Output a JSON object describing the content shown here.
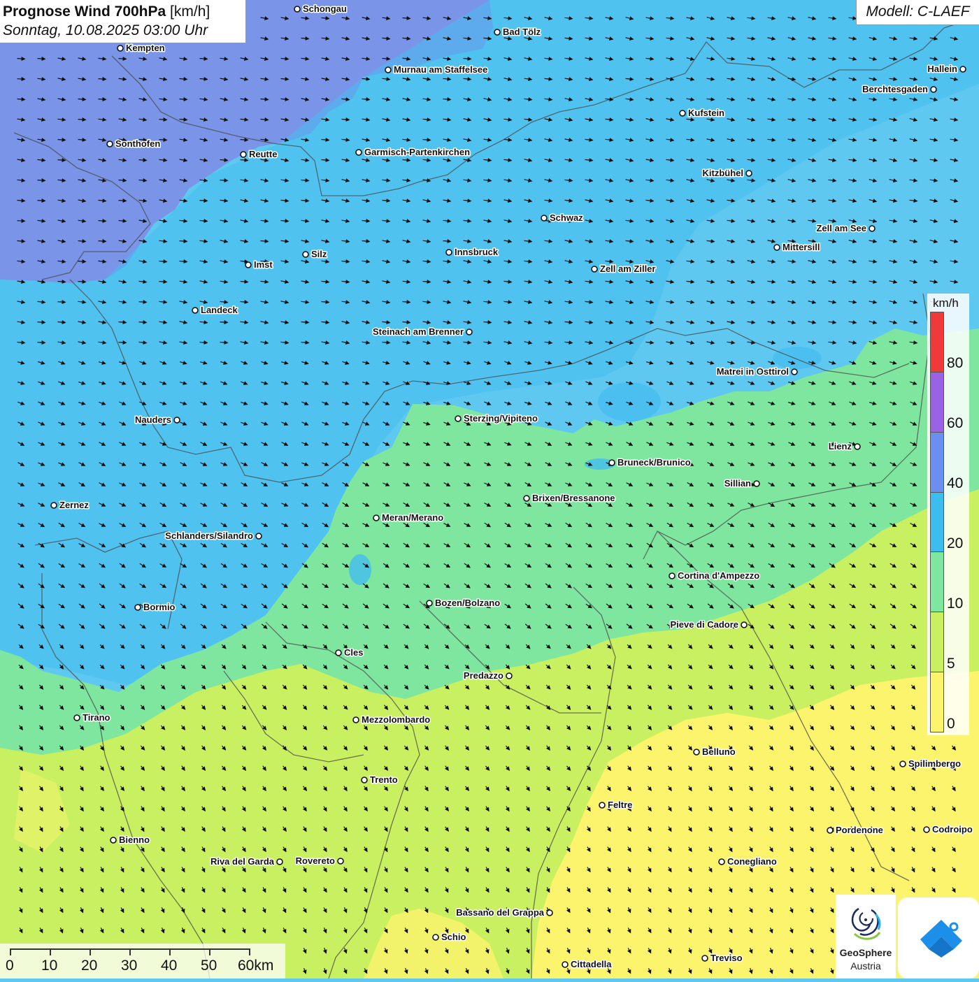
{
  "header": {
    "title_bold": "Prognose Wind 700hPa",
    "title_unit": "[km/h]",
    "datetime": "Sonntag, 10.08.2025 03:00 Uhr"
  },
  "model": "Modell: C-LAEF",
  "legend": {
    "unit": "km/h",
    "colors": [
      "#f03a3a",
      "#9a63e6",
      "#6a8fee",
      "#3cbcef",
      "#7ee69e",
      "#c9f060",
      "#fdf46d"
    ],
    "ticks": [
      "80",
      "60",
      "40",
      "20",
      "10",
      "5",
      "0"
    ]
  },
  "scale_bar": {
    "labels": [
      "0",
      "10",
      "20",
      "30",
      "40",
      "50",
      "60km"
    ]
  },
  "cities": [
    {
      "name": "Schongau"
    },
    {
      "name": "Bad Tölz"
    },
    {
      "name": "Kempten"
    },
    {
      "name": "Murnau am Staffelsee"
    },
    {
      "name": "Hallein"
    },
    {
      "name": "Berchtesgaden"
    },
    {
      "name": "Kufstein"
    },
    {
      "name": "Sonthofen"
    },
    {
      "name": "Reutte"
    },
    {
      "name": "Garmisch-Partenkirchen"
    },
    {
      "name": "Kitzbühel"
    },
    {
      "name": "Schwaz"
    },
    {
      "name": "Zell am See"
    },
    {
      "name": "Mittersill"
    },
    {
      "name": "Silz"
    },
    {
      "name": "Innsbruck"
    },
    {
      "name": "Imst"
    },
    {
      "name": "Zell am Ziller"
    },
    {
      "name": "Landeck"
    },
    {
      "name": "Steinach am Brenner"
    },
    {
      "name": "Matrei in Osttirol"
    },
    {
      "name": "Nauders"
    },
    {
      "name": "Sterzing/Vipiteno"
    },
    {
      "name": "Lienz"
    },
    {
      "name": "Bruneck/Brunico"
    },
    {
      "name": "Sillian"
    },
    {
      "name": "Brixen/Bressanone"
    },
    {
      "name": "Zernez"
    },
    {
      "name": "Meran/Merano"
    },
    {
      "name": "Schlanders/Silandro"
    },
    {
      "name": "Cortina d'Ampezzo"
    },
    {
      "name": "Bozen/Bolzano"
    },
    {
      "name": "Bormio"
    },
    {
      "name": "Pieve di Cadore"
    },
    {
      "name": "Cles"
    },
    {
      "name": "Predazzo"
    },
    {
      "name": "Tirano"
    },
    {
      "name": "Mezzolombardo"
    },
    {
      "name": "Belluno"
    },
    {
      "name": "Spilimbergo"
    },
    {
      "name": "Trento"
    },
    {
      "name": "Feltre"
    },
    {
      "name": "Pordenone"
    },
    {
      "name": "Codroipo"
    },
    {
      "name": "Bienno"
    },
    {
      "name": "Riva del Garda"
    },
    {
      "name": "Rovereto"
    },
    {
      "name": "Conegliano"
    },
    {
      "name": "Bassano del Grappa"
    },
    {
      "name": "Schio"
    },
    {
      "name": "Treviso"
    },
    {
      "name": "Cittadella"
    }
  ],
  "logo": {
    "name": "GeoSphere",
    "sub": "Austria"
  }
}
